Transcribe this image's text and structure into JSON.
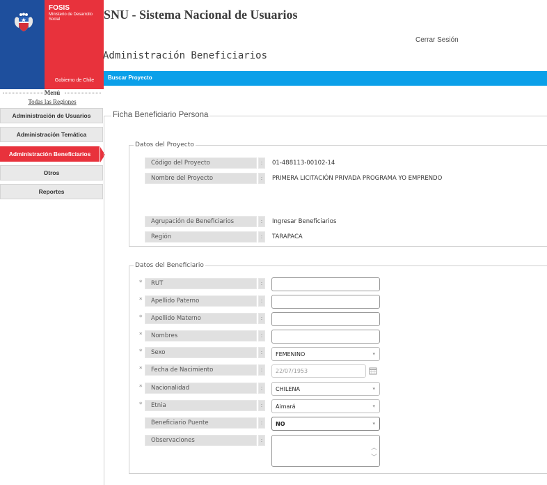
{
  "logo": {
    "brand": "FOSIS",
    "ministry": "Ministerio de Desarrollo Social",
    "government": "Gobierno de Chile"
  },
  "header": {
    "app_title": "SNU - Sistema Nacional de Usuarios",
    "logout": "Cerrar Sesión",
    "section_title": "Administración Beneficiarios",
    "bar_link": "Buscar Proyecto"
  },
  "sidebar": {
    "menu_title": "Menú",
    "regions_link": "Todas las Regiones",
    "items": [
      {
        "label": "Administración de Usuarios",
        "active": false
      },
      {
        "label": "Administración Temática",
        "active": false
      },
      {
        "label": "Administración Beneficiarios",
        "active": true
      },
      {
        "label": "Otros",
        "active": false
      },
      {
        "label": "Reportes",
        "active": false
      }
    ]
  },
  "ficha": {
    "legend": "Ficha Beneficiario Persona",
    "proyecto": {
      "legend": "Datos del Proyecto",
      "rows": [
        {
          "label": "Código del Proyecto",
          "value": "01-488113-00102-14"
        },
        {
          "label": "Nombre del Proyecto",
          "value": "PRIMERA LICITACIÓN PRIVADA PROGRAMA YO EMPRENDO"
        },
        {
          "label": "Agrupación de Beneficiarios",
          "value": "Ingresar Beneficiarios"
        },
        {
          "label": "Región",
          "value": "TARAPACA"
        }
      ]
    },
    "beneficiario": {
      "legend": "Datos del Beneficiario",
      "required_mark": "*",
      "fields": {
        "rut": {
          "label": "RUT",
          "value": ""
        },
        "apellido_paterno": {
          "label": "Apellido Paterno",
          "value": ""
        },
        "apellido_materno": {
          "label": "Apellido Materno",
          "value": ""
        },
        "nombres": {
          "label": "Nombres",
          "value": ""
        },
        "sexo": {
          "label": "Sexo",
          "value": "FEMENINO"
        },
        "fecha_nacimiento": {
          "label": "Fecha de Nacimiento",
          "value": "22/07/1953"
        },
        "nacionalidad": {
          "label": "Nacionalidad",
          "value": "CHILENA"
        },
        "etnia": {
          "label": "Etnia",
          "value": "Aimará"
        },
        "beneficiario_puente": {
          "label": "Beneficiario Puente",
          "value": "NO"
        },
        "observaciones": {
          "label": "Observaciones",
          "value": ""
        }
      }
    }
  },
  "colors": {
    "blue_bar": "#0ba0e9",
    "accent_red": "#e8323c",
    "logo_blue": "#1e4f9d",
    "label_gray": "#e0e0e0"
  },
  "icons": {
    "select_caret": "▾",
    "scroll_up": "︿",
    "scroll_down": "﹀"
  }
}
